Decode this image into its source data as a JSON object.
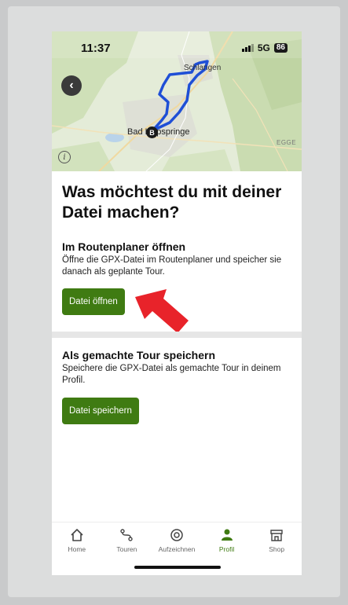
{
  "status_bar": {
    "time": "11:37",
    "network": "5G",
    "battery": "86"
  },
  "map": {
    "labels": {
      "town_north": "Schlangen",
      "town_south": "Bad Lippspringe",
      "region": "EGGE"
    },
    "marker": "B"
  },
  "heading": "Was möchtest du mit deiner Datei machen?",
  "sections": [
    {
      "title": "Im Routenplaner öffnen",
      "description": "Öffne die GPX-Datei im Routenplaner und speicher sie danach als geplante Tour.",
      "button": "Datei öffnen"
    },
    {
      "title": "Als gemachte Tour speichern",
      "description": "Speichere die GPX-Datei als gemachte Tour in deinem Profil.",
      "button": "Datei speichern"
    }
  ],
  "tabs": [
    {
      "label": "Home",
      "icon": "home-icon"
    },
    {
      "label": "Touren",
      "icon": "route-icon"
    },
    {
      "label": "Aufzeichnen",
      "icon": "record-icon"
    },
    {
      "label": "Profil",
      "icon": "person-icon",
      "active": true
    },
    {
      "label": "Shop",
      "icon": "shop-icon"
    }
  ],
  "colors": {
    "accent": "#3f7b12",
    "route": "#1f4fd6",
    "arrow": "#e8232a"
  }
}
